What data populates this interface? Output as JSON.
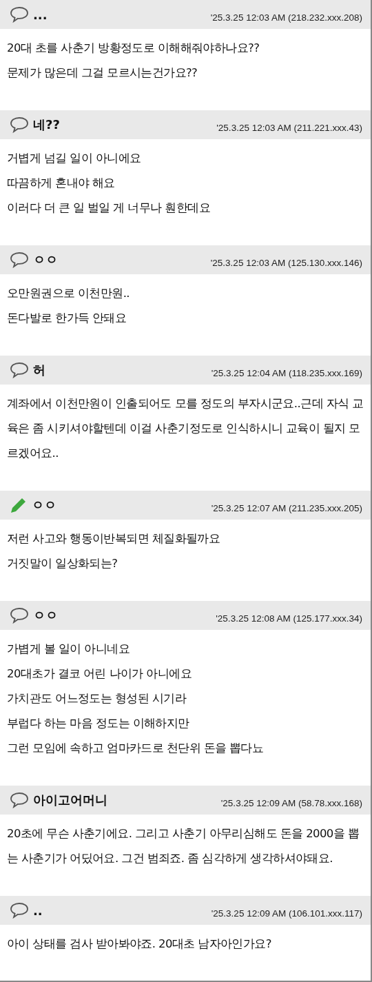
{
  "comments": [
    {
      "kind": "comment",
      "author": "...",
      "time": "'25.3.25 12:03 AM (218.232.xxx.208)",
      "lines": [
        "20대 초를 사춘기 방황정도로 이해해줘야하나요??",
        "문제가 많은데 그걸 모르시는건가요??"
      ]
    },
    {
      "kind": "comment",
      "author": "네??",
      "time": "'25.3.25 12:03 AM (211.221.xxx.43)",
      "lines": [
        "거볍게 넘길 일이 아니에요",
        "따끔하게 혼내야 해요",
        "이러다 더 큰 일 벌일 게 너무나 훤한데요"
      ]
    },
    {
      "kind": "comment",
      "author": "ㅇㅇ",
      "time": "'25.3.25 12:03 AM (125.130.xxx.146)",
      "lines": [
        "오만원권으로 이천만원..",
        "돈다발로 한가득 안돼요"
      ]
    },
    {
      "kind": "comment",
      "author": "허",
      "time": "'25.3.25 12:04 AM (118.235.xxx.169)",
      "lines": [
        "계좌에서 이천만원이 인출되어도 모를 정도의 부자시군요..근데 자식 교육은 좀 시키셔야할텐데 이걸 사춘기정도로 인식하시니 교육이 될지 모르겠어요.."
      ]
    },
    {
      "kind": "edited",
      "author": "ㅇㅇ",
      "time": "'25.3.25 12:07 AM (211.235.xxx.205)",
      "lines": [
        "저런 사고와 행동이반복되면 체질화될까요",
        "거짓말이 일상화되는?"
      ]
    },
    {
      "kind": "comment",
      "author": "ㅇㅇ",
      "time": "'25.3.25 12:08 AM (125.177.xxx.34)",
      "lines": [
        "가볍게 볼 일이 아니네요",
        "20대초가 결코 어린 나이가 아니에요",
        "가치관도 어느정도는 형성된 시기라",
        "부럽다 하는 마음 정도는 이해하지만",
        "그런 모임에 속하고 엄마카드로 천단위 돈을 뽑다뇨"
      ]
    },
    {
      "kind": "comment",
      "author": "아이고어머니",
      "time": "'25.3.25 12:09 AM (58.78.xxx.168)",
      "lines": [
        "20초에 무슨 사춘기에요. 그리고 사춘기 아무리심해도 돈을 2000을 뽑는 사춘기가 어딨어요. 그건 범죄죠. 좀 심각하게 생각하셔야돼요."
      ]
    },
    {
      "kind": "comment",
      "author": "..",
      "time": "'25.3.25 12:09 AM (106.101.xxx.117)",
      "lines": [
        "아이 상태를 검사 받아봐야죠. 20대초 남자아인가요?"
      ]
    }
  ]
}
